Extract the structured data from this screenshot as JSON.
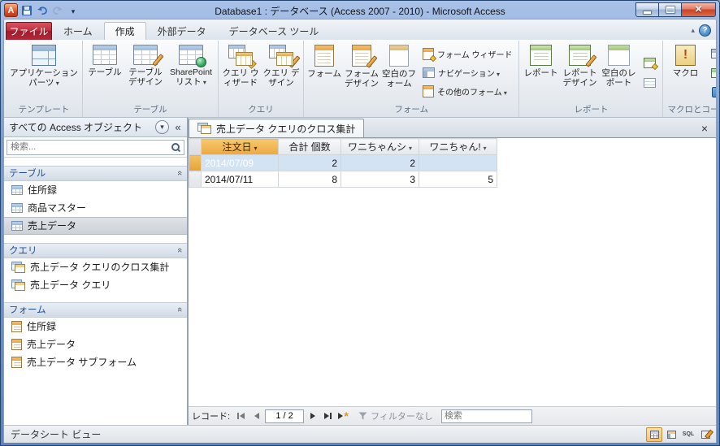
{
  "window": {
    "title": "Database1 : データベース (Access 2007 - 2010) - Microsoft Access"
  },
  "ribbon": {
    "file_tab": "ファイル",
    "tabs": [
      "ホーム",
      "作成",
      "外部データ",
      "データベース ツール"
    ],
    "groups": [
      {
        "label": "テンプレート",
        "buttons": [
          {
            "label": "アプリケーション パーツ",
            "icon": "application-parts-icon",
            "dropdown": true
          }
        ]
      },
      {
        "label": "テーブル",
        "buttons": [
          {
            "label": "テーブル",
            "icon": "table-icon"
          },
          {
            "label": "テーブル デザイン",
            "icon": "table-design-icon"
          },
          {
            "label": "SharePoint リスト",
            "icon": "sharepoint-lists-icon",
            "dropdown": true
          }
        ]
      },
      {
        "label": "クエリ",
        "buttons": [
          {
            "label": "クエリ ウィザード",
            "icon": "query-wizard-icon"
          },
          {
            "label": "クエリ デザイン",
            "icon": "query-design-icon"
          }
        ]
      },
      {
        "label": "フォーム",
        "buttons": [
          {
            "label": "フォーム",
            "icon": "form-icon"
          },
          {
            "label": "フォーム デザイン",
            "icon": "form-design-icon"
          },
          {
            "label": "空白のフォーム",
            "icon": "blank-form-icon"
          }
        ],
        "small": [
          {
            "label": "フォーム ウィザード",
            "icon": "form-wizard-icon"
          },
          {
            "label": "ナビゲーション",
            "icon": "navigation-icon",
            "dropdown": true
          },
          {
            "label": "その他のフォーム",
            "icon": "more-forms-icon",
            "dropdown": true
          }
        ]
      },
      {
        "label": "レポート",
        "buttons": [
          {
            "label": "レポート",
            "icon": "report-icon"
          },
          {
            "label": "レポート デザイン",
            "icon": "report-design-icon"
          },
          {
            "label": "空白のレポート",
            "icon": "blank-report-icon"
          }
        ],
        "small_icons": [
          "report-wizard-icon",
          "labels-icon"
        ]
      },
      {
        "label": "マクロとコード",
        "buttons": [
          {
            "label": "マクロ",
            "icon": "macro-icon"
          }
        ],
        "small_icons": [
          "module-icon",
          "class-module-icon",
          "visual-basic-icon"
        ]
      }
    ]
  },
  "navpane": {
    "title": "すべての Access オブジェクト",
    "search_placeholder": "検索...",
    "sections": [
      {
        "name": "テーブル",
        "items": [
          {
            "label": "住所録",
            "icon": "table-icon"
          },
          {
            "label": "商品マスター",
            "icon": "table-icon"
          },
          {
            "label": "売上データ",
            "icon": "table-icon",
            "selected": true
          }
        ]
      },
      {
        "name": "クエリ",
        "items": [
          {
            "label": "売上データ クエリのクロス集計",
            "icon": "crosstab-query-icon"
          },
          {
            "label": "売上データ クエリ",
            "icon": "query-icon"
          }
        ]
      },
      {
        "name": "フォーム",
        "items": [
          {
            "label": "住所録",
            "icon": "form-icon"
          },
          {
            "label": "売上データ",
            "icon": "form-icon"
          },
          {
            "label": "売上データ サブフォーム",
            "icon": "form-icon"
          }
        ]
      }
    ]
  },
  "document": {
    "tab_title": "売上データ クエリのクロス集計",
    "table": {
      "columns": [
        {
          "label": "注文日",
          "dropdown": true,
          "selected": true
        },
        {
          "label": "合計 個数",
          "dropdown": false
        },
        {
          "label": "ワニちゃんシ",
          "dropdown": true
        },
        {
          "label": "ワニちゃん!",
          "dropdown": true
        }
      ],
      "rows": [
        [
          "2014/07/09",
          "2",
          "2",
          ""
        ],
        [
          "2014/07/11",
          "8",
          "3",
          "5"
        ]
      ],
      "selected_cell": {
        "row": 0,
        "column": 0
      }
    },
    "record_nav": {
      "label": "レコード:",
      "position": "1 / 2",
      "filter_label": "フィルターなし",
      "search_placeholder": "検索"
    }
  },
  "statusbar": {
    "view_label": "データシート ビュー",
    "sql_label": "SQL"
  }
}
